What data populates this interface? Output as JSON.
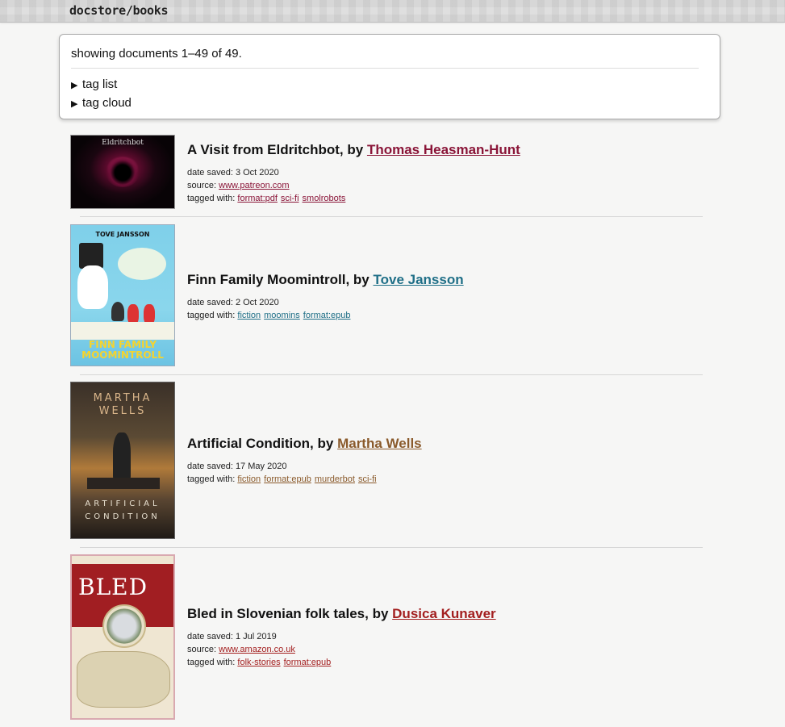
{
  "header": {
    "title": "docstore/books"
  },
  "summary": {
    "text": "showing documents 1–49 of 49.",
    "details": [
      {
        "label": "tag list"
      },
      {
        "label": "tag cloud"
      }
    ]
  },
  "labels": {
    "date_saved": "date saved:",
    "source": "source:",
    "tagged_with": "tagged with:",
    "by": ", by"
  },
  "books": [
    {
      "title": "A Visit from Eldritchbot",
      "author": "Thomas Heasman-Hunt",
      "date_saved": "3 Oct 2020",
      "source": "www.patreon.com",
      "tags": [
        "format:pdf",
        "sci-fi",
        "smolrobots"
      ],
      "accent": "#8a1538",
      "cover_text": "Eldritchbot"
    },
    {
      "title": "Finn Family Moomintroll",
      "author": "Tove Jansson",
      "date_saved": "2 Oct 2020",
      "tags": [
        "fiction",
        "moomins",
        "format:epub"
      ],
      "accent": "#1f6f87",
      "cover_text": "TOVE JANSSON",
      "cover_text2": "FINN FAMILY MOOMINTROLL"
    },
    {
      "title": "Artificial Condition",
      "author": "Martha Wells",
      "date_saved": "17 May 2020",
      "tags": [
        "fiction",
        "format:epub",
        "murderbot",
        "sci-fi"
      ],
      "accent": "#8a5a2b",
      "cover_text": "MARTHA WELLS",
      "cover_text2": "ARTIFICIAL CONDITION"
    },
    {
      "title": "Bled in Slovenian folk tales",
      "author": "Dusica Kunaver",
      "date_saved": "1 Jul 2019",
      "source": "www.amazon.co.uk",
      "tags": [
        "folk-stories",
        "format:epub"
      ],
      "accent": "#a31f1f",
      "cover_text": "BLED"
    }
  ]
}
